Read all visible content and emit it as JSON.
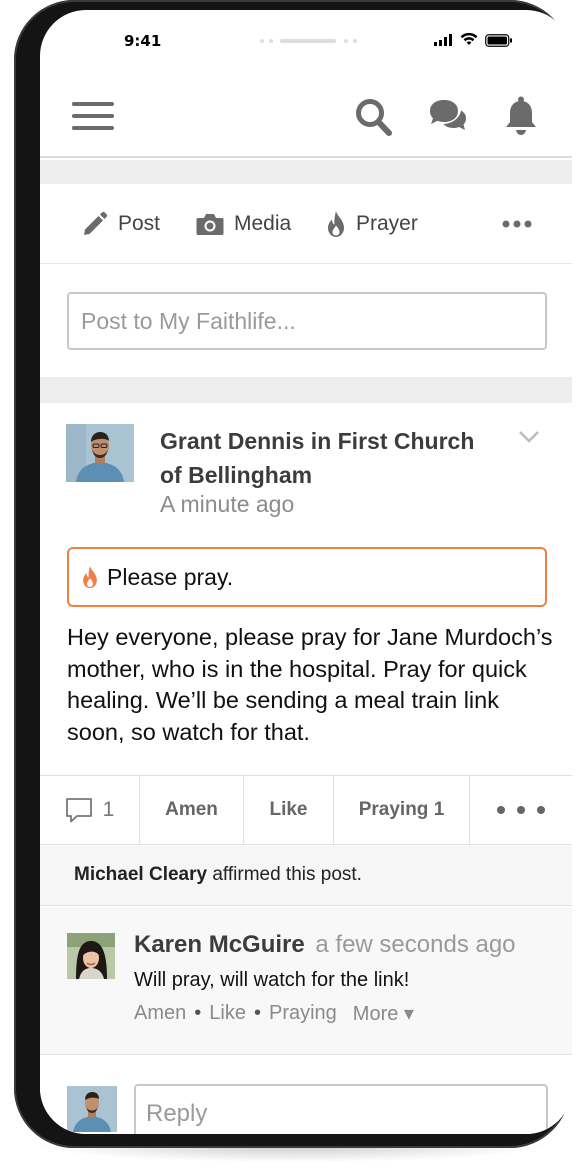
{
  "status_bar": {
    "time": "9:41"
  },
  "nav": {
    "icons": [
      "menu-icon",
      "search-icon",
      "chat-icon",
      "bell-icon"
    ]
  },
  "composer": {
    "actions": [
      {
        "label": "Post",
        "icon": "pencil-icon"
      },
      {
        "label": "Media",
        "icon": "camera-icon"
      },
      {
        "label": "Prayer",
        "icon": "flame-icon"
      }
    ],
    "more_icon": "ellipsis-icon",
    "placeholder": "Post to My Faithlife..."
  },
  "post": {
    "author_line": "Grant Dennis in First Church of Bellingham",
    "timestamp": "A minute ago",
    "prayer_callout": "Please pray.",
    "body": "Hey everyone, please pray for Jane Murdoch’s mother, who is in the hospital. Pray for quick healing. We’ll be sending a meal train link soon, so watch for that.",
    "comment_count": "1",
    "reactions": {
      "amen": "Amen",
      "like": "Like",
      "praying": "Praying 1"
    },
    "affirmation": {
      "name": "Michael Cleary",
      "text": "affirmed this post."
    }
  },
  "comment": {
    "name": "Karen McGuire",
    "time": "a few seconds ago",
    "text": "Will pray, will watch for the link!",
    "actions": {
      "amen": "Amen",
      "like": "Like",
      "praying": "Praying",
      "more": "More ▾"
    }
  },
  "reply": {
    "placeholder": "Reply"
  },
  "colors": {
    "accent_orange": "#f07e45",
    "icon_gray": "#6b6b6b",
    "divider_gray": "#ededed"
  }
}
